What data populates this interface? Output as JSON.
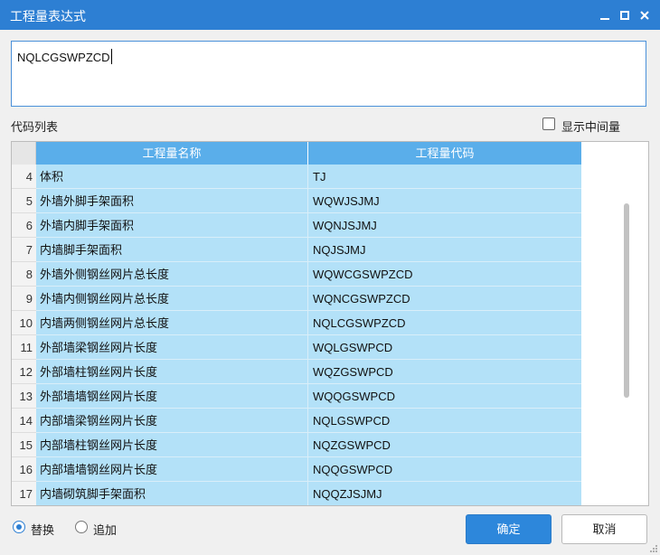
{
  "window": {
    "title": "工程量表达式",
    "minimize_icon": "minimize-icon",
    "maximize_icon": "maximize-icon",
    "close_icon": "close-icon"
  },
  "expression": {
    "value": "NQLCGSWPZCD"
  },
  "code_list": {
    "label": "代码列表",
    "show_intermediate_label": "显示中间量",
    "show_intermediate_checked": false,
    "columns": [
      "工程量名称",
      "工程量代码"
    ],
    "rows": [
      {
        "num": "4",
        "name": "体积",
        "code": "TJ"
      },
      {
        "num": "5",
        "name": "外墙外脚手架面积",
        "code": "WQWJSJMJ"
      },
      {
        "num": "6",
        "name": "外墙内脚手架面积",
        "code": "WQNJSJMJ"
      },
      {
        "num": "7",
        "name": "内墙脚手架面积",
        "code": "NQJSJMJ"
      },
      {
        "num": "8",
        "name": "外墙外侧钢丝网片总长度",
        "code": "WQWCGSWPZCD"
      },
      {
        "num": "9",
        "name": "外墙内侧钢丝网片总长度",
        "code": "WQNCGSWPZCD"
      },
      {
        "num": "10",
        "name": "内墙两侧钢丝网片总长度",
        "code": "NQLCGSWPZCD"
      },
      {
        "num": "11",
        "name": "外部墙梁钢丝网片长度",
        "code": "WQLGSWPCD"
      },
      {
        "num": "12",
        "name": "外部墙柱钢丝网片长度",
        "code": "WQZGSWPCD"
      },
      {
        "num": "13",
        "name": "外部墙墙钢丝网片长度",
        "code": "WQQGSWPCD"
      },
      {
        "num": "14",
        "name": "内部墙梁钢丝网片长度",
        "code": "NQLGSWPCD"
      },
      {
        "num": "15",
        "name": "内部墙柱钢丝网片长度",
        "code": "NQZGSWPCD"
      },
      {
        "num": "16",
        "name": "内部墙墙钢丝网片长度",
        "code": "NQQGSWPCD"
      },
      {
        "num": "17",
        "name": "内墙砌筑脚手架面积",
        "code": "NQQZJSJMJ"
      }
    ]
  },
  "mode": {
    "replace_label": "替换",
    "append_label": "追加",
    "selected": "替换"
  },
  "buttons": {
    "ok": "确定",
    "cancel": "取消"
  },
  "colors": {
    "titlebar": "#2d7fd3",
    "header": "#5aaeea",
    "row_highlight": "#b3e1f8",
    "ok_button": "#2d87db"
  }
}
